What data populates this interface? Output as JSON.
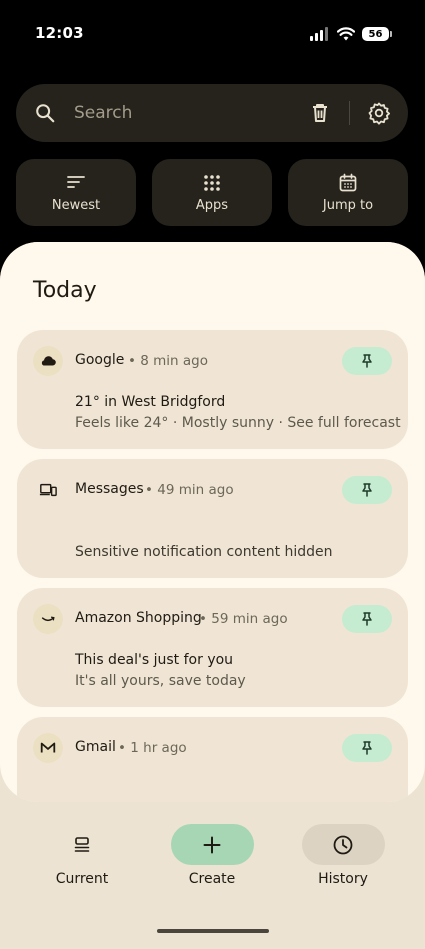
{
  "status_bar": {
    "time": "12:03",
    "battery": "56"
  },
  "search": {
    "placeholder": "Search"
  },
  "chips": [
    {
      "label": "Newest",
      "icon": "sort-icon"
    },
    {
      "label": "Apps",
      "icon": "apps-grid-icon"
    },
    {
      "label": "Jump to",
      "icon": "calendar-icon"
    }
  ],
  "section_title": "Today",
  "notifications": [
    {
      "app": "Google",
      "time": "8 min ago",
      "line1": "21° in West Bridgford",
      "line2": "Feels like 24° · Mostly sunny · See full forecast",
      "icon": "cloud-icon"
    },
    {
      "app": "Messages",
      "time": "49 min ago",
      "line1": "",
      "line2": "Sensitive notification content hidden",
      "icon": "devices-icon"
    },
    {
      "app": "Amazon Shopping",
      "time": "59 min ago",
      "line1": "This deal's just for you",
      "line2": "It's all yours, save today",
      "icon": "amazon-smile-icon"
    },
    {
      "app": "Gmail",
      "time": "1 hr ago",
      "line1": "",
      "line2": "",
      "icon": "gmail-icon"
    }
  ],
  "bottom_nav": [
    {
      "label": "Current",
      "icon": "stack-icon",
      "active": false
    },
    {
      "label": "Create",
      "icon": "plus-icon",
      "active": true
    },
    {
      "label": "History",
      "icon": "clock-icon",
      "active": false
    }
  ],
  "colors": {
    "background_dark": "#000000",
    "surface_dark": "#25231c",
    "panel": "#fff8ec",
    "card": "#f0e5d4",
    "pin_green": "#c5ecd0",
    "create_green": "#a7d6b4",
    "history_pill": "#ddd3c2"
  }
}
